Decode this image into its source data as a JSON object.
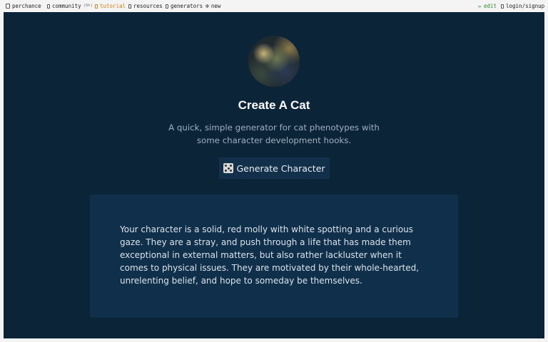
{
  "topbar": {
    "items": [
      {
        "label": "perchance"
      },
      {
        "label": "community",
        "badge": "(6h)"
      },
      {
        "label": "tutorial"
      },
      {
        "label": "resources"
      },
      {
        "label": "generators"
      },
      {
        "label": "new"
      }
    ],
    "edit_label": "edit",
    "login_label": "login/signup"
  },
  "page": {
    "title": "Create A Cat",
    "subtitle": "A quick, simple generator for cat phenotypes with some character development hooks.",
    "generate_button_label": "Generate Character",
    "output_text": "Your character is a solid, red molly with white spotting and a curious gaze. They are a stray, and push through a life that has made them exceptional in external matters, but also rather lackluster when it comes to physical issues. They are motivated by their whole-hearted, unrelenting belief, and hope to someday be themselves."
  },
  "colors": {
    "background": "#0c2438",
    "panel": "#0f2f4b",
    "button": "#123049",
    "tutorial_accent": "#d4831c",
    "edit_accent": "#2e8b2e"
  },
  "icons": {
    "home": "dice-icon",
    "community": "chat-icon",
    "tutorial": "book-icon",
    "resources": "book-icon",
    "generators": "list-icon",
    "new": "plus-circle-icon",
    "edit": "pencil-icon",
    "login": "user-icon",
    "generate": "dice-icon"
  }
}
